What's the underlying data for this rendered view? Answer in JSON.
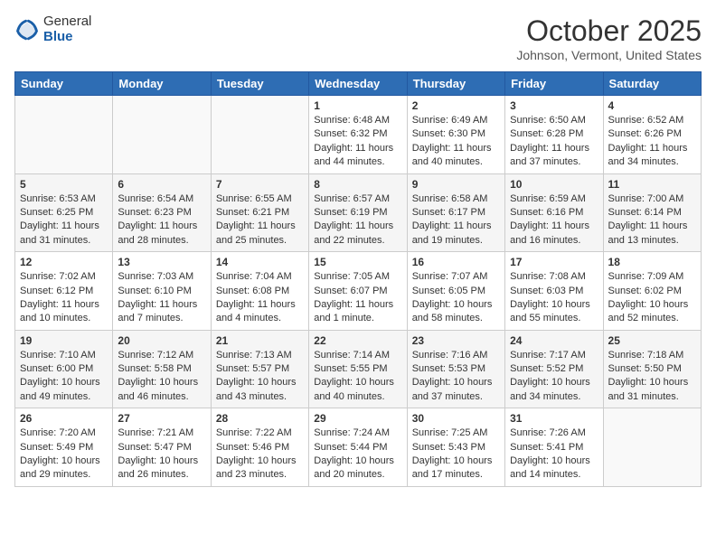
{
  "header": {
    "logo_general": "General",
    "logo_blue": "Blue",
    "month_title": "October 2025",
    "location": "Johnson, Vermont, United States"
  },
  "days_of_week": [
    "Sunday",
    "Monday",
    "Tuesday",
    "Wednesday",
    "Thursday",
    "Friday",
    "Saturday"
  ],
  "weeks": [
    [
      {
        "day": "",
        "sunrise": "",
        "sunset": "",
        "daylight": ""
      },
      {
        "day": "",
        "sunrise": "",
        "sunset": "",
        "daylight": ""
      },
      {
        "day": "",
        "sunrise": "",
        "sunset": "",
        "daylight": ""
      },
      {
        "day": "1",
        "sunrise": "Sunrise: 6:48 AM",
        "sunset": "Sunset: 6:32 PM",
        "daylight": "Daylight: 11 hours and 44 minutes."
      },
      {
        "day": "2",
        "sunrise": "Sunrise: 6:49 AM",
        "sunset": "Sunset: 6:30 PM",
        "daylight": "Daylight: 11 hours and 40 minutes."
      },
      {
        "day": "3",
        "sunrise": "Sunrise: 6:50 AM",
        "sunset": "Sunset: 6:28 PM",
        "daylight": "Daylight: 11 hours and 37 minutes."
      },
      {
        "day": "4",
        "sunrise": "Sunrise: 6:52 AM",
        "sunset": "Sunset: 6:26 PM",
        "daylight": "Daylight: 11 hours and 34 minutes."
      }
    ],
    [
      {
        "day": "5",
        "sunrise": "Sunrise: 6:53 AM",
        "sunset": "Sunset: 6:25 PM",
        "daylight": "Daylight: 11 hours and 31 minutes."
      },
      {
        "day": "6",
        "sunrise": "Sunrise: 6:54 AM",
        "sunset": "Sunset: 6:23 PM",
        "daylight": "Daylight: 11 hours and 28 minutes."
      },
      {
        "day": "7",
        "sunrise": "Sunrise: 6:55 AM",
        "sunset": "Sunset: 6:21 PM",
        "daylight": "Daylight: 11 hours and 25 minutes."
      },
      {
        "day": "8",
        "sunrise": "Sunrise: 6:57 AM",
        "sunset": "Sunset: 6:19 PM",
        "daylight": "Daylight: 11 hours and 22 minutes."
      },
      {
        "day": "9",
        "sunrise": "Sunrise: 6:58 AM",
        "sunset": "Sunset: 6:17 PM",
        "daylight": "Daylight: 11 hours and 19 minutes."
      },
      {
        "day": "10",
        "sunrise": "Sunrise: 6:59 AM",
        "sunset": "Sunset: 6:16 PM",
        "daylight": "Daylight: 11 hours and 16 minutes."
      },
      {
        "day": "11",
        "sunrise": "Sunrise: 7:00 AM",
        "sunset": "Sunset: 6:14 PM",
        "daylight": "Daylight: 11 hours and 13 minutes."
      }
    ],
    [
      {
        "day": "12",
        "sunrise": "Sunrise: 7:02 AM",
        "sunset": "Sunset: 6:12 PM",
        "daylight": "Daylight: 11 hours and 10 minutes."
      },
      {
        "day": "13",
        "sunrise": "Sunrise: 7:03 AM",
        "sunset": "Sunset: 6:10 PM",
        "daylight": "Daylight: 11 hours and 7 minutes."
      },
      {
        "day": "14",
        "sunrise": "Sunrise: 7:04 AM",
        "sunset": "Sunset: 6:08 PM",
        "daylight": "Daylight: 11 hours and 4 minutes."
      },
      {
        "day": "15",
        "sunrise": "Sunrise: 7:05 AM",
        "sunset": "Sunset: 6:07 PM",
        "daylight": "Daylight: 11 hours and 1 minute."
      },
      {
        "day": "16",
        "sunrise": "Sunrise: 7:07 AM",
        "sunset": "Sunset: 6:05 PM",
        "daylight": "Daylight: 10 hours and 58 minutes."
      },
      {
        "day": "17",
        "sunrise": "Sunrise: 7:08 AM",
        "sunset": "Sunset: 6:03 PM",
        "daylight": "Daylight: 10 hours and 55 minutes."
      },
      {
        "day": "18",
        "sunrise": "Sunrise: 7:09 AM",
        "sunset": "Sunset: 6:02 PM",
        "daylight": "Daylight: 10 hours and 52 minutes."
      }
    ],
    [
      {
        "day": "19",
        "sunrise": "Sunrise: 7:10 AM",
        "sunset": "Sunset: 6:00 PM",
        "daylight": "Daylight: 10 hours and 49 minutes."
      },
      {
        "day": "20",
        "sunrise": "Sunrise: 7:12 AM",
        "sunset": "Sunset: 5:58 PM",
        "daylight": "Daylight: 10 hours and 46 minutes."
      },
      {
        "day": "21",
        "sunrise": "Sunrise: 7:13 AM",
        "sunset": "Sunset: 5:57 PM",
        "daylight": "Daylight: 10 hours and 43 minutes."
      },
      {
        "day": "22",
        "sunrise": "Sunrise: 7:14 AM",
        "sunset": "Sunset: 5:55 PM",
        "daylight": "Daylight: 10 hours and 40 minutes."
      },
      {
        "day": "23",
        "sunrise": "Sunrise: 7:16 AM",
        "sunset": "Sunset: 5:53 PM",
        "daylight": "Daylight: 10 hours and 37 minutes."
      },
      {
        "day": "24",
        "sunrise": "Sunrise: 7:17 AM",
        "sunset": "Sunset: 5:52 PM",
        "daylight": "Daylight: 10 hours and 34 minutes."
      },
      {
        "day": "25",
        "sunrise": "Sunrise: 7:18 AM",
        "sunset": "Sunset: 5:50 PM",
        "daylight": "Daylight: 10 hours and 31 minutes."
      }
    ],
    [
      {
        "day": "26",
        "sunrise": "Sunrise: 7:20 AM",
        "sunset": "Sunset: 5:49 PM",
        "daylight": "Daylight: 10 hours and 29 minutes."
      },
      {
        "day": "27",
        "sunrise": "Sunrise: 7:21 AM",
        "sunset": "Sunset: 5:47 PM",
        "daylight": "Daylight: 10 hours and 26 minutes."
      },
      {
        "day": "28",
        "sunrise": "Sunrise: 7:22 AM",
        "sunset": "Sunset: 5:46 PM",
        "daylight": "Daylight: 10 hours and 23 minutes."
      },
      {
        "day": "29",
        "sunrise": "Sunrise: 7:24 AM",
        "sunset": "Sunset: 5:44 PM",
        "daylight": "Daylight: 10 hours and 20 minutes."
      },
      {
        "day": "30",
        "sunrise": "Sunrise: 7:25 AM",
        "sunset": "Sunset: 5:43 PM",
        "daylight": "Daylight: 10 hours and 17 minutes."
      },
      {
        "day": "31",
        "sunrise": "Sunrise: 7:26 AM",
        "sunset": "Sunset: 5:41 PM",
        "daylight": "Daylight: 10 hours and 14 minutes."
      },
      {
        "day": "",
        "sunrise": "",
        "sunset": "",
        "daylight": ""
      }
    ]
  ]
}
